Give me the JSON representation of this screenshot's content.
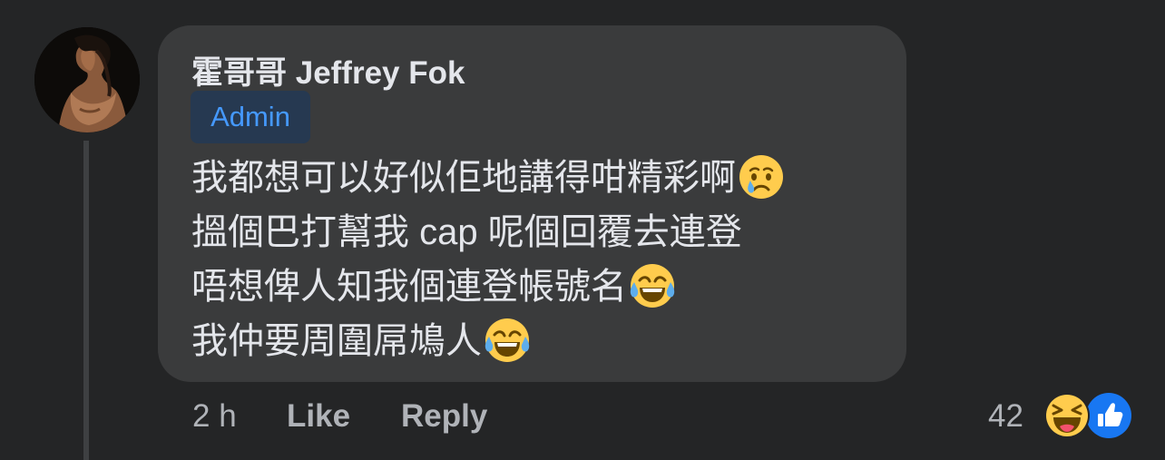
{
  "comment": {
    "author": "霍哥哥 Jeffrey Fok",
    "badge": "Admin",
    "lines": [
      "我都想可以好似佢地講得咁精彩啊",
      "搵個巴打幫我 cap 呢個回覆去連登",
      "唔想俾人知我個連登帳號名",
      "我仲要周圍屌鳩人"
    ],
    "line_emojis": [
      "crying-face",
      "none",
      "tears-of-joy",
      "tears-of-joy"
    ]
  },
  "actions": {
    "time": "2 h",
    "like_label": "Like",
    "reply_label": "Reply"
  },
  "reactions": {
    "count": "42",
    "types": [
      "haha-icon",
      "like-icon"
    ]
  },
  "colors": {
    "background": "#242526",
    "bubble": "#3a3b3c",
    "text": "#e4e6eb",
    "muted": "#b0b3b8",
    "badge_bg": "#263951",
    "badge_text": "#4599ff",
    "like_blue": "#1877f2",
    "emoji_yellow": "#ffcc4d"
  }
}
